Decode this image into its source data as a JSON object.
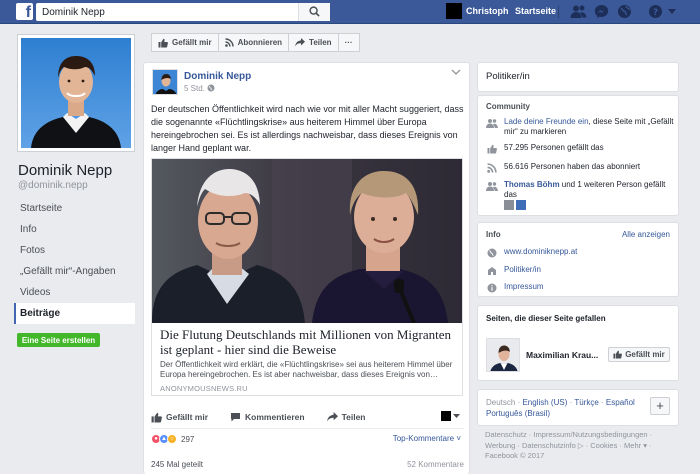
{
  "topbar": {
    "search_value": "Dominik Nepp",
    "user_name": "Christoph",
    "home_label": "Startseite",
    "brand_color": "#3b5998"
  },
  "profile": {
    "name": "Dominik Nepp",
    "handle": "@dominik.nepp",
    "nav": [
      "Startseite",
      "Info",
      "Fotos",
      "„Gefällt mir“-Angaben",
      "Videos",
      "Beiträge"
    ],
    "active_nav": "Beiträge",
    "create_page_label": "Eine Seite erstellen"
  },
  "action_bar": {
    "like": "Gefällt mir",
    "follow": "Abonnieren",
    "share": "Teilen",
    "more": "···"
  },
  "post": {
    "author": "Dominik Nepp",
    "time": "5 Std. ·",
    "text": "Der deutschen Öffentlichkeit wird nach wie vor mit aller Macht suggeriert, dass die sogenannte «Flüchtlingskrise» aus heiterem Himmel über Europa hereingebrochen sei. Es ist allerdings nachweisbar, dass dieses Ereignis von langer Hand geplant war.",
    "link": {
      "title": "Die Flutung Deutschlands mit Millionen von Migranten ist geplant - hier sind die Beweise",
      "description": "Der Öffentlichkeit wird erklärt, die «Flüchtlingskrise» sei aus heiterem Himmel über Europa hereingebrochen. Es ist aber nachweisbar, dass dieses Ereignis von…",
      "domain": "ANONYMOUSNEWS.RU"
    },
    "actions": {
      "like": "Gefällt mir",
      "comment": "Kommentieren",
      "share": "Teilen"
    },
    "reaction_count": "297",
    "top_comments": "Top-Kommentare ˅",
    "shares": "245 Mal geteilt",
    "comments": "52 Kommentare"
  },
  "sidebar": {
    "category": "Politiker/in",
    "community": {
      "heading": "Community",
      "invite_link": "Lade deine Freunde ein",
      "invite_text": ", diese Seite mit „Gefällt mir“ zu markieren",
      "likes": "57.295 Personen gefällt das",
      "followers": "56.616 Personen haben das abonniert",
      "friend_link": "Thomas Böhm",
      "friend_text": " und 1 weiteren Person gefällt das"
    },
    "info": {
      "heading": "Info",
      "edit": "Alle anzeigen",
      "website": "www.dominiknepp.at",
      "category": "Politiker/in",
      "impressum": "Impressum"
    },
    "liked_pages": {
      "heading": "Seiten, die dieser Seite gefallen",
      "name": "Maximilian Krau...",
      "button": "Gefällt mir"
    },
    "languages": {
      "current": "Deutsch · ",
      "links": [
        "English (US)",
        "Türkçe",
        "Español",
        "Português (Brasil)"
      ]
    },
    "footer": "Datenschutz · Impressum/Nutzungsbedingungen · Werbung · Datenschutzinfo ▷ · Cookies · Mehr ▾ · Facebook © 2017"
  }
}
